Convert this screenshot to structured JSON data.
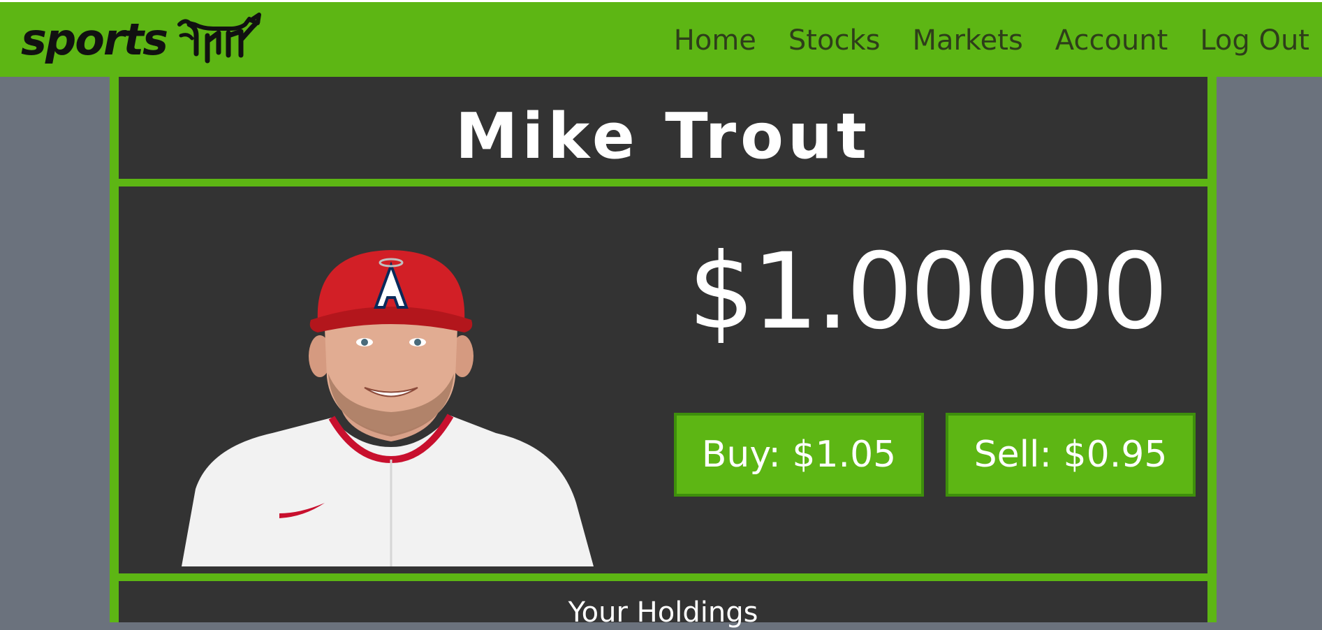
{
  "brand": {
    "logo_text": "sports",
    "logo_icon": "bull-chart-icon"
  },
  "nav": {
    "items": [
      {
        "label": "Home"
      },
      {
        "label": "Stocks"
      },
      {
        "label": "Markets"
      },
      {
        "label": "Account"
      },
      {
        "label": "Log Out"
      }
    ]
  },
  "player": {
    "name": "Mike Trout",
    "price": "$1.00000",
    "photo_alt": "player-photo"
  },
  "trade": {
    "buy_label": "Buy: $1.05",
    "sell_label": "Sell: $0.95"
  },
  "holdings": {
    "title": "Your Holdings"
  },
  "colors": {
    "accent": "#5db614",
    "panel": "#333333",
    "page_bg": "#6b727d"
  }
}
